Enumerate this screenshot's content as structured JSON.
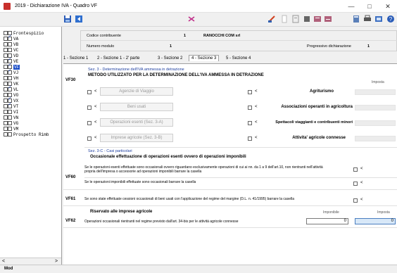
{
  "window": {
    "title": "2019 - Dichiarazione IVA - Quadro VF",
    "controls": {
      "minimize": "—",
      "maximize": "□",
      "close": "✕"
    }
  },
  "colors": {
    "accent": "#1e3fa0",
    "selected": "#1e50c8",
    "input_highlight": "#d8e8f8"
  },
  "toolbar": {
    "icons": [
      "save-icon",
      "back-icon",
      "close-form-icon",
      "stamp-icon",
      "page-icon",
      "doc-icon",
      "grid-icon",
      "data-icon",
      "data2-icon",
      "calc-icon",
      "print-icon",
      "preview-icon",
      "help-icon"
    ]
  },
  "sidebar": {
    "items": [
      {
        "label": "Frontespizio",
        "checked": false
      },
      {
        "label": "VA",
        "checked": true
      },
      {
        "label": "VB",
        "checked": false
      },
      {
        "label": "VC",
        "checked": false
      },
      {
        "label": "VD",
        "checked": false
      },
      {
        "label": "VE",
        "checked": true
      },
      {
        "label": "VF",
        "checked": true,
        "selected": true
      },
      {
        "label": "VJ",
        "checked": true
      },
      {
        "label": "VH",
        "checked": false
      },
      {
        "label": "VK",
        "checked": false
      },
      {
        "label": "VL",
        "checked": true
      },
      {
        "label": "VO",
        "checked": false
      },
      {
        "label": "VX",
        "checked": true
      },
      {
        "label": "VT",
        "checked": true
      },
      {
        "label": "VI",
        "checked": false
      },
      {
        "label": "VN",
        "checked": false
      },
      {
        "label": "VG",
        "checked": false
      },
      {
        "label": "VM",
        "checked": false
      },
      {
        "label": "Prospetto Rimb",
        "checked": false
      }
    ],
    "scroll_left": "<",
    "scroll_right": ">"
  },
  "header": {
    "codice_label": "Codice contribuente",
    "codice_value": "1",
    "ragione_sociale": "RANOCCHI COM srl",
    "numero_modulo_label": "Numero modulo",
    "numero_modulo_value": "1",
    "progressivo_label": "Progressivo dichiarazione",
    "progressivo_value": "1"
  },
  "tabs": [
    {
      "label": "1 - Sezione 1",
      "active": false
    },
    {
      "label": "2 - Sezione 1 - 2' parte",
      "active": false
    },
    {
      "label": "3 - Sezione 2",
      "active": false
    },
    {
      "label": "4 - Sezione 3",
      "active": true
    },
    {
      "label": "5 - Sezione 4",
      "active": false
    }
  ],
  "vf30": {
    "code": "VF30",
    "section_title": "Sez. 3 - Determinazione dell'IVA ammessa in detrazione",
    "heading": "METODO UTILIZZATO PER LA DETERMINAZIONE DELL'IVA AMMESSA IN DETRAZIONE",
    "imposta_label": "Imposta",
    "left_buttons": [
      "Agenzie di Viaggio",
      "Beni usati",
      "Operazioni esenti (Sez. 3-A)",
      "Imprese agricole (Sez. 3-B)"
    ],
    "right_labels": [
      "Agriturismo",
      "Associazioni operanti in agricoltura",
      "Spettacoli viaggianti e contribuenti minori",
      "Attivita' agricole connesse"
    ],
    "lt": "<"
  },
  "sez3c": {
    "title": "Sez. 3-C - Casi particolari",
    "heading": "Occasionale effettuazione di operazioni esenti ovvero di operazioni imponibili",
    "vf60_code": "VF60",
    "vf60_text1": "Se le operazioni esenti effettuate sono occasionali ovvero riguardano esclusivamente operazioni di cui ai nn. da 1 a 9 dell'art.10, non rientranti nell'attività propria dell'impresa o accessorie ad operazioni imponibili barrare la casella",
    "vf60_text2": "Se le operazioni imponibili effettuate sono occasionali barrare la casella",
    "vf61_code": "VF61",
    "vf61_text": "Se sono state effettuate cessioni occasionali di beni usati con l'applicazione del regime del margine (D.L. n. 41/1995) barrare la casella",
    "riservato": "Riservato alle imprese agricole",
    "imponibile_label": "Imponibile",
    "imposta_label": "Imposta",
    "vf62_code": "VF62",
    "vf62_text": "Operazioni occasionali rientranti nel regime previsto dall'art. 34-bis per le attività agricole connesse",
    "imponibile_value": "0",
    "imposta_value": "0"
  },
  "status": {
    "text": "Mod"
  }
}
